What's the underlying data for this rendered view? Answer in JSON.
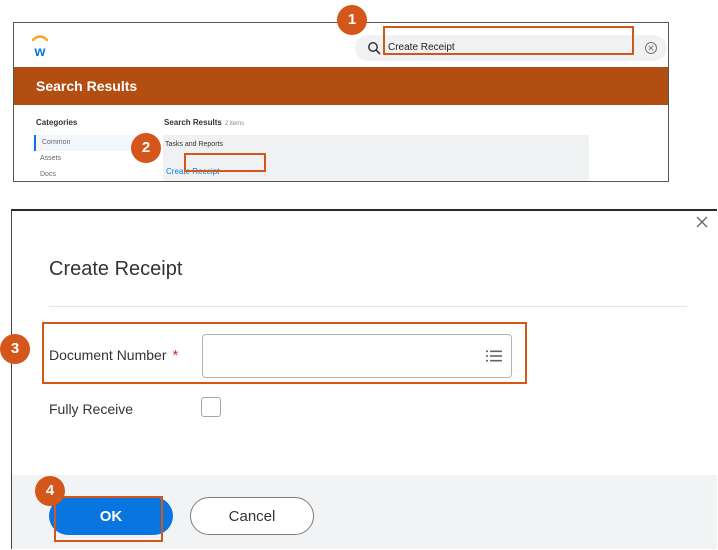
{
  "colors": {
    "accent": "#0875e1",
    "header_band": "#b34e12",
    "annotation": "#d4561b",
    "required": "#d92c2c"
  },
  "search_screen": {
    "logo_icon": "workday-logo-icon",
    "search": {
      "value": "Create Receipt",
      "icon": "search-icon",
      "clear_icon": "clear-circle-icon"
    },
    "header_title": "Search Results",
    "categories": {
      "label": "Categories",
      "items": [
        {
          "label": "Common",
          "selected": true
        },
        {
          "label": "Assets",
          "selected": false
        },
        {
          "label": "Docs",
          "selected": false
        }
      ]
    },
    "results": {
      "label": "Search Results",
      "count": "2 items",
      "section_label": "Tasks and Reports",
      "link": "Create Receipt"
    }
  },
  "dialog": {
    "title": "Create Receipt",
    "close_icon": "close-icon",
    "fields": {
      "document_number": {
        "label": "Document Number",
        "required_marker": "*",
        "value": "",
        "prompt_icon": "prompt-list-icon"
      },
      "fully_receive": {
        "label": "Fully Receive",
        "checked": false
      }
    },
    "ok_label": "OK",
    "cancel_label": "Cancel"
  },
  "annotations": {
    "step1": "1",
    "step2": "2",
    "step3": "3",
    "step4": "4"
  }
}
